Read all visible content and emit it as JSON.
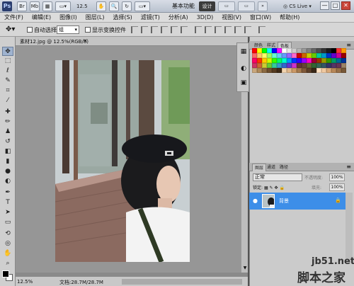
{
  "titlebar": {
    "zoom": "12.5",
    "workspace_label": "基本功能",
    "workspace_active": "设计",
    "cslive": "CS Live",
    "minimize": "—",
    "restore": "□",
    "close": "✕"
  },
  "menu": [
    "文件(F)",
    "编辑(E)",
    "图像(I)",
    "图层(L)",
    "选择(S)",
    "滤镜(T)",
    "分析(A)",
    "3D(D)",
    "视图(V)",
    "窗口(W)",
    "帮助(H)"
  ],
  "options": {
    "auto_select_label": "自动选择:",
    "auto_select_value": "组",
    "show_transform_label": "显示变换控件"
  },
  "document": {
    "tab_title": "素材12.jpg @ 12.5%(RGB/8)",
    "close": "×",
    "status_zoom": "12.5%",
    "status_doc": "文档:28.7M/28.7M"
  },
  "panels": {
    "color_tabs": [
      "颜色",
      "样式",
      "色板"
    ],
    "layers_tabs": [
      "图层",
      "通道",
      "路径"
    ],
    "blend_mode": "正常",
    "opacity_label": "不透明度:",
    "opacity_value": "100%",
    "lock_label": "锁定:",
    "fill_label": "填充:",
    "fill_value": "100%",
    "layer_name": "背景"
  },
  "colors": {
    "swatches": [
      "#ff0000",
      "#ffff00",
      "#00ff00",
      "#00ffff",
      "#0000ff",
      "#ff00ff",
      "#ffffff",
      "#e6e6e6",
      "#cccccc",
      "#b3b3b3",
      "#999999",
      "#808080",
      "#666666",
      "#4d4d4d",
      "#333333",
      "#1a1a1a",
      "#000000",
      "#ff3333",
      "#ff9900",
      "#ff6666",
      "#ffcc66",
      "#ffff66",
      "#99ff66",
      "#66ffcc",
      "#66ccff",
      "#6699ff",
      "#9966ff",
      "#ff66cc",
      "#cc0000",
      "#cc6600",
      "#cccc00",
      "#66cc00",
      "#00cc99",
      "#0099cc",
      "#0033cc",
      "#6600cc",
      "#cc0099",
      "#990000",
      "#ff0066",
      "#ff3300",
      "#ffcc00",
      "#ccff00",
      "#33ff00",
      "#00ff66",
      "#00ffcc",
      "#0099ff",
      "#0033ff",
      "#3300ff",
      "#9900ff",
      "#ff00cc",
      "#990033",
      "#993300",
      "#999900",
      "#339900",
      "#009966",
      "#006699",
      "#003399",
      "#cc3366",
      "#cc6633",
      "#cccc33",
      "#66cc33",
      "#33cc99",
      "#3399cc",
      "#3366cc",
      "#6633cc",
      "#cc33cc",
      "#663333",
      "#664433",
      "#666633",
      "#336633",
      "#336655",
      "#335566",
      "#333366",
      "#553366",
      "#663355",
      "#9c8466",
      "#c9a77c",
      "#b08a5a",
      "#8c6a42",
      "#6e4f2e",
      "#553b20",
      "#3e2a16",
      "#f2d4b0",
      "#e0b88c",
      "#cc9966",
      "#a67a4d",
      "#80593a",
      "#5c3f29",
      "#3a2818",
      "#ffe0c0",
      "#f0c8a0",
      "#d8a878",
      "#b88858",
      "#987048",
      "#785838"
    ]
  }
}
